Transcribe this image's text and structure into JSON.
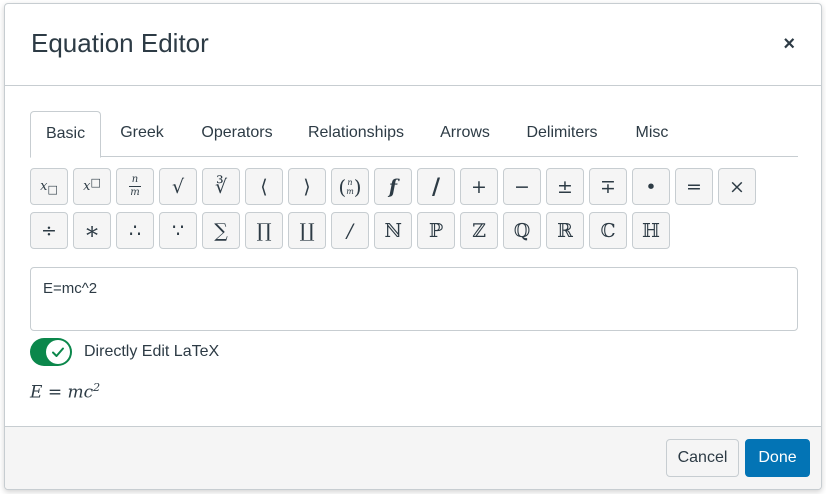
{
  "dialog": {
    "title": "Equation Editor",
    "close_label": "×"
  },
  "tabs": [
    {
      "label": "Basic",
      "active": true
    },
    {
      "label": "Greek"
    },
    {
      "label": "Operators"
    },
    {
      "label": "Relationships"
    },
    {
      "label": "Arrows"
    },
    {
      "label": "Delimiters"
    },
    {
      "label": "Misc"
    }
  ],
  "palette": {
    "row1": [
      "subscript",
      "superscript",
      "fraction",
      "√",
      "∛",
      "⟨",
      "⟩",
      "binomial",
      "f",
      "/",
      "+",
      "−",
      "±",
      "∓",
      "•",
      "=",
      "×"
    ],
    "row2": [
      "÷",
      "∗",
      "∴",
      "∵",
      "∑",
      "∏",
      "∐",
      "/",
      "ℕ",
      "ℙ",
      "ℤ",
      "ℚ",
      "ℝ",
      "ℂ",
      "ℍ"
    ]
  },
  "editor": {
    "latex_value": "E=mc^2"
  },
  "toggle": {
    "label": "Directly Edit LaTeX",
    "checked": true
  },
  "preview": {
    "base": "E = mc",
    "exponent": "2"
  },
  "footer": {
    "cancel_label": "Cancel",
    "done_label": "Done"
  },
  "colors": {
    "toggle_on": "#0b874b",
    "primary": "#0374b5",
    "text": "#2d3b45",
    "border": "#c7cdd1"
  }
}
